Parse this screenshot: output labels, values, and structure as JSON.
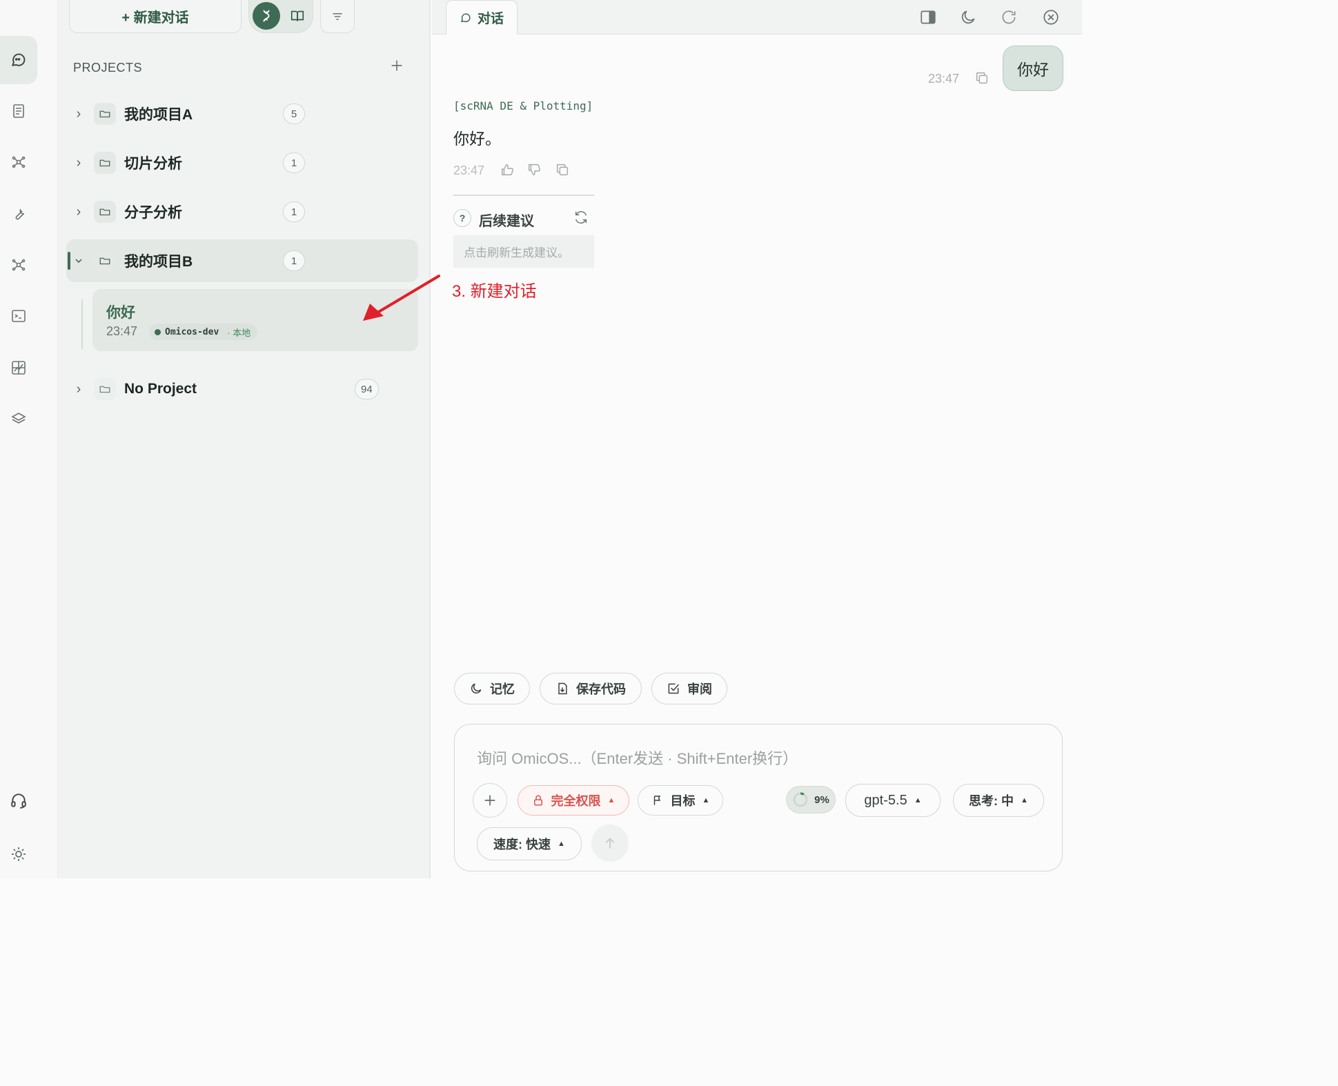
{
  "toolbar": {
    "new_chat_label": "+ 新建对话"
  },
  "projects": {
    "header": "PROJECTS",
    "items": [
      {
        "name": "我的项目A",
        "count": "5"
      },
      {
        "name": "切片分析",
        "count": "1"
      },
      {
        "name": "分子分析",
        "count": "1"
      },
      {
        "name": "我的项目B",
        "count": "1"
      }
    ],
    "session": {
      "title": "你好",
      "time": "23:47",
      "env": "Omicos-dev",
      "location": "· 本地"
    },
    "no_project": {
      "name": "No Project",
      "count": "94"
    }
  },
  "tab": {
    "label": "对话"
  },
  "chat": {
    "user_message": "你好",
    "user_time": "23:47",
    "skill_tag": "[scRNA DE & Plotting]",
    "assistant_message": "你好。",
    "assistant_time": "23:47",
    "suggestions": {
      "title": "后续建议",
      "placeholder": "点击刷新生成建议。"
    }
  },
  "annotation": {
    "label": "3. 新建对话",
    "color": "#e0202a"
  },
  "quick_actions": {
    "memory": "记忆",
    "save_code": "保存代码",
    "review": "审阅"
  },
  "composer": {
    "placeholder": "询问 OmicOS...（Enter发送 · Shift+Enter换行）",
    "permission": "完全权限",
    "goal": "目标",
    "usage": "9%",
    "usage_value": 0.09,
    "model": "gpt-5.5",
    "thinking": "思考: 中",
    "speed": "速度: 快速"
  },
  "colors": {
    "accent": "#2f5a44",
    "danger": "#d9534f"
  }
}
